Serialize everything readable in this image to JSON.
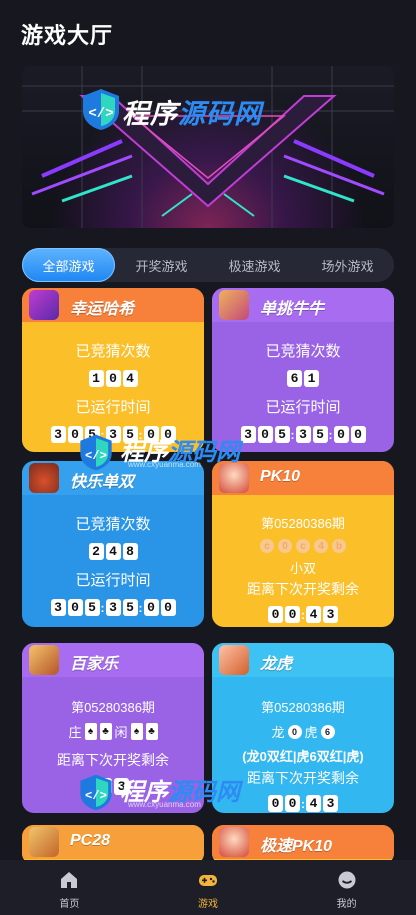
{
  "header": {
    "title": "游戏大厅"
  },
  "banner": {
    "brand_part1": "程序",
    "brand_part2": "源码网"
  },
  "tabs": [
    {
      "label": "全部游戏",
      "active": true
    },
    {
      "label": "开奖游戏",
      "active": false
    },
    {
      "label": "极速游戏",
      "active": false
    },
    {
      "label": "场外游戏",
      "active": false
    }
  ],
  "common": {
    "count_label": "已竞猜次数",
    "runtime_label": "已运行时间",
    "countdown_label": "距离下次开奖剩余",
    "issue": "第05280386期"
  },
  "games": {
    "xingyun": {
      "name": "幸运哈希",
      "count": [
        "1",
        "0",
        "4"
      ],
      "time": [
        "3",
        "0",
        "5",
        "3",
        "5",
        "0",
        "0"
      ]
    },
    "danniu": {
      "name": "单挑牛牛",
      "count": [
        "6",
        "1"
      ],
      "time": [
        "3",
        "0",
        "5",
        "3",
        "5",
        "0",
        "0"
      ]
    },
    "kuaile": {
      "name": "快乐单双",
      "count": [
        "2",
        "4",
        "8"
      ],
      "time": [
        "3",
        "0",
        "5",
        "3",
        "5",
        "0",
        "0"
      ]
    },
    "pk10": {
      "name": "PK10",
      "balls": [
        "c",
        "0",
        "c",
        "4",
        "b"
      ],
      "result": "小双",
      "countdown": [
        "0",
        "0",
        "4",
        "3"
      ]
    },
    "baijia": {
      "name": "百家乐",
      "zhuang": "庄",
      "xian": "闲",
      "countdown": [
        "4",
        "3"
      ]
    },
    "longhu": {
      "name": "龙虎",
      "long": "龙",
      "long_ball": "0",
      "hu": "虎",
      "hu_ball": "6",
      "detail": "(龙0双红|虎6双红|虎)",
      "countdown": [
        "0",
        "0",
        "4",
        "3"
      ]
    },
    "pc28": {
      "name": "PC28"
    },
    "jisu_pk10": {
      "name": "极速PK10"
    }
  },
  "watermark": {
    "part1": "程序",
    "part2": "源码网",
    "url": "www.cxyuanma.com"
  },
  "bottom_nav": [
    {
      "label": "首页",
      "icon": "home-icon",
      "active": false
    },
    {
      "label": "游戏",
      "icon": "gamepad-icon",
      "active": true
    },
    {
      "label": "我的",
      "icon": "user-icon",
      "active": false
    }
  ],
  "colors": {
    "accent": "#2c8cf2",
    "active_nav": "#f4b43c",
    "background": "#17181f"
  }
}
